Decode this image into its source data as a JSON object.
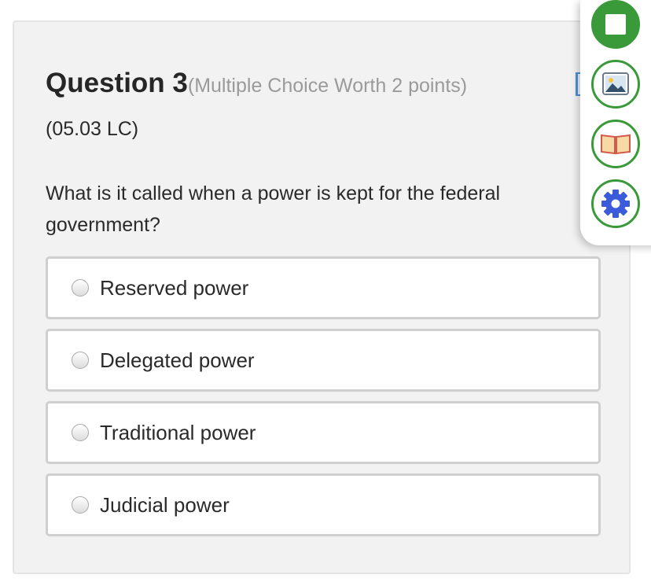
{
  "question": {
    "title": "Question 3",
    "worth": "(Multiple Choice Worth 2 points)",
    "code": "(05.03 LC)",
    "text": "What is it called when a power is kept for the federal government?"
  },
  "options": [
    {
      "label": "Reserved power",
      "selected": false
    },
    {
      "label": "Delegated power",
      "selected": false
    },
    {
      "label": "Traditional power",
      "selected": false
    },
    {
      "label": "Judicial power",
      "selected": false
    }
  ],
  "toolbar": {
    "buttons": [
      {
        "icon": "stop-icon",
        "color": "#3a9a3a"
      },
      {
        "icon": "image-icon",
        "color": "#3a9a3a"
      },
      {
        "icon": "book-icon",
        "color": "#3a9a3a"
      },
      {
        "icon": "settings-gear-icon",
        "color": "#3b5bdb"
      }
    ]
  },
  "colors": {
    "accent_green": "#3a9a3a",
    "gear_blue": "#3b5bdb",
    "card_background": "#f2f2f2"
  }
}
